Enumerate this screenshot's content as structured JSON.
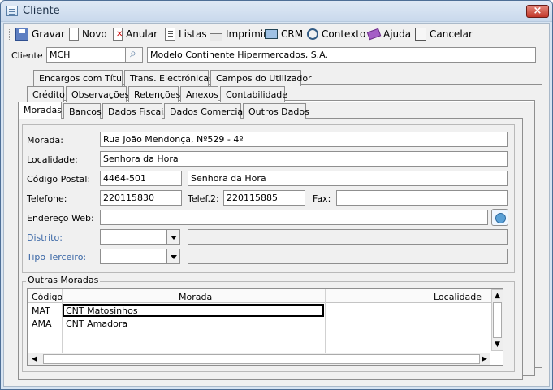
{
  "window": {
    "title": "Cliente"
  },
  "toolbar": {
    "save": "Gravar",
    "new": "Novo",
    "void": "Anular",
    "lists": "Listas",
    "print": "Imprimir",
    "crm": "CRM",
    "context": "Contexto",
    "help": "Ajuda",
    "cancel": "Cancelar"
  },
  "client": {
    "label": "Cliente :",
    "code": "MCH",
    "name": "Modelo Continente Hipermercados, S.A."
  },
  "tabs": {
    "row1": [
      "Encargos com Títulos",
      "Trans. Electrónicas",
      "Campos do Utilizador"
    ],
    "row2": [
      "Crédito",
      "Observações",
      "Retenções",
      "Anexos",
      "Contabilidade"
    ],
    "row3": [
      "Moradas",
      "Bancos",
      "Dados Fiscais",
      "Dados Comerciais",
      "Outros Dados"
    ]
  },
  "address": {
    "morada_label": "Morada:",
    "morada": "Rua João Mendonça, Nº529 - 4º",
    "localidade_label": "Localidade:",
    "localidade": "Senhora da Hora",
    "postal_label": "Código Postal:",
    "postal_code": "4464-501",
    "postal_locality": "Senhora da Hora",
    "phone_label": "Telefone:",
    "phone": "220115830",
    "phone2_label": "Telef.2:",
    "phone2": "220115885",
    "fax_label": "Fax:",
    "fax": "",
    "web_label": "Endereço Web:",
    "web": "",
    "district_label": "Distrito:",
    "district": "",
    "third_party_label": "Tipo Terceiro:",
    "third_party_type": ""
  },
  "other_addresses": {
    "title": "Outras Moradas",
    "columns": [
      "Código",
      "Morada",
      "Localidade"
    ],
    "rows": [
      {
        "code": "MAT",
        "address": "CNT Matosinhos",
        "locality": ""
      },
      {
        "code": "AMA",
        "address": "CNT Amadora",
        "locality": ""
      }
    ]
  },
  "colors": {
    "link_label": "#3a67a6",
    "title_bar": "#c9d9ec"
  }
}
